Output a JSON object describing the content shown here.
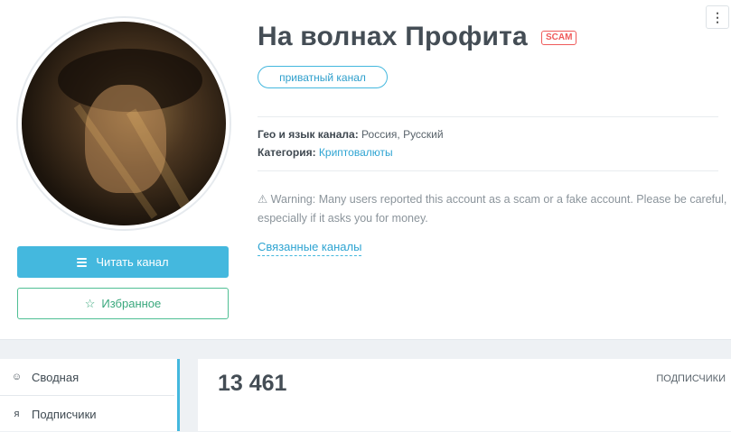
{
  "channel": {
    "title": "На волнах Профита",
    "scam_badge": "SCAM",
    "private_badge": "приватный канал",
    "geo_label": "Гео и язык канала:",
    "geo_value": "Россия, Русский",
    "category_label": "Категория:",
    "category_value": "Криптовалюты",
    "warning": "⚠ Warning: Many users reported this account as a scam or a fake account. Please be careful, especially if it asks you for money.",
    "related_link": "Связанные каналы"
  },
  "actions": {
    "read_label": "Читать канал",
    "favorite_label": "Избранное",
    "favorite_icon": "☆",
    "more_icon": "⋮"
  },
  "sidebar": {
    "items": [
      {
        "label": "Сводная",
        "icon": "☺"
      },
      {
        "label": "Подписчики",
        "icon": "ᴙ"
      }
    ]
  },
  "stats": {
    "subscribers_value": "13 461",
    "subscribers_label": "ПОДПИСЧИКИ"
  },
  "colors": {
    "accent": "#44b8de",
    "favorite": "#4fbf94",
    "scam": "#ef5b5b"
  }
}
